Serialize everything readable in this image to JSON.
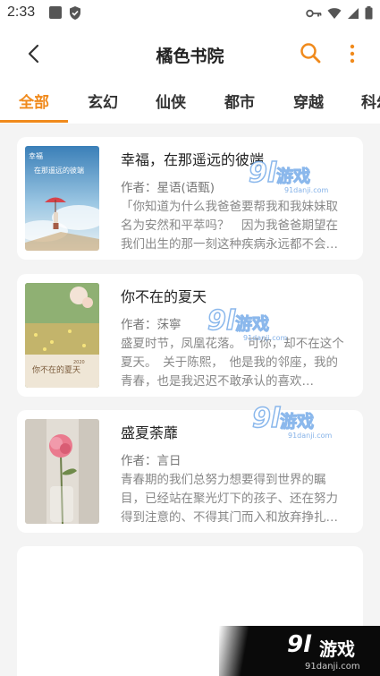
{
  "status_bar": {
    "time": "2:33"
  },
  "header": {
    "title": "橘色书院"
  },
  "tabs": [
    {
      "label": "全部",
      "active": true
    },
    {
      "label": "玄幻",
      "active": false
    },
    {
      "label": "仙侠",
      "active": false
    },
    {
      "label": "都市",
      "active": false
    },
    {
      "label": "穿越",
      "active": false
    },
    {
      "label": "科幻",
      "active": false
    }
  ],
  "books": [
    {
      "title": "幸福，在那遥远的彼端",
      "author": "作者：星语(语甄)",
      "description": "「你知道为什么我爸爸要帮我和我妹妹取名为安然和平萃吗？　因为我爸爸期望在我们出生的那一刻这种疾病永远都不会…",
      "cover_text": "在那遥远的彼端"
    },
    {
      "title": "你不在的夏天",
      "author": "作者：莯寧",
      "description": "盛夏时节，凤凰花落。　可你，却不在这个夏天。　关于陈熙，　他是我的邻座，我的青春，也是我迟迟不敢承认的喜欢…",
      "cover_text": "你不在的夏天"
    },
    {
      "title": "盛夏荼蘼",
      "author": "作者：言日",
      "description": "青春期的我们总努力想要得到世界的瞩目，已经站在聚光灯下的孩子、还在努力得到注意的、不得其门而入和放弃挣扎…",
      "cover_text": ""
    }
  ],
  "watermark": {
    "number": "9l",
    "text": "游戏",
    "url": "91danji.com"
  },
  "colors": {
    "accent": "#f08a1c",
    "background": "#f4f4f4"
  }
}
